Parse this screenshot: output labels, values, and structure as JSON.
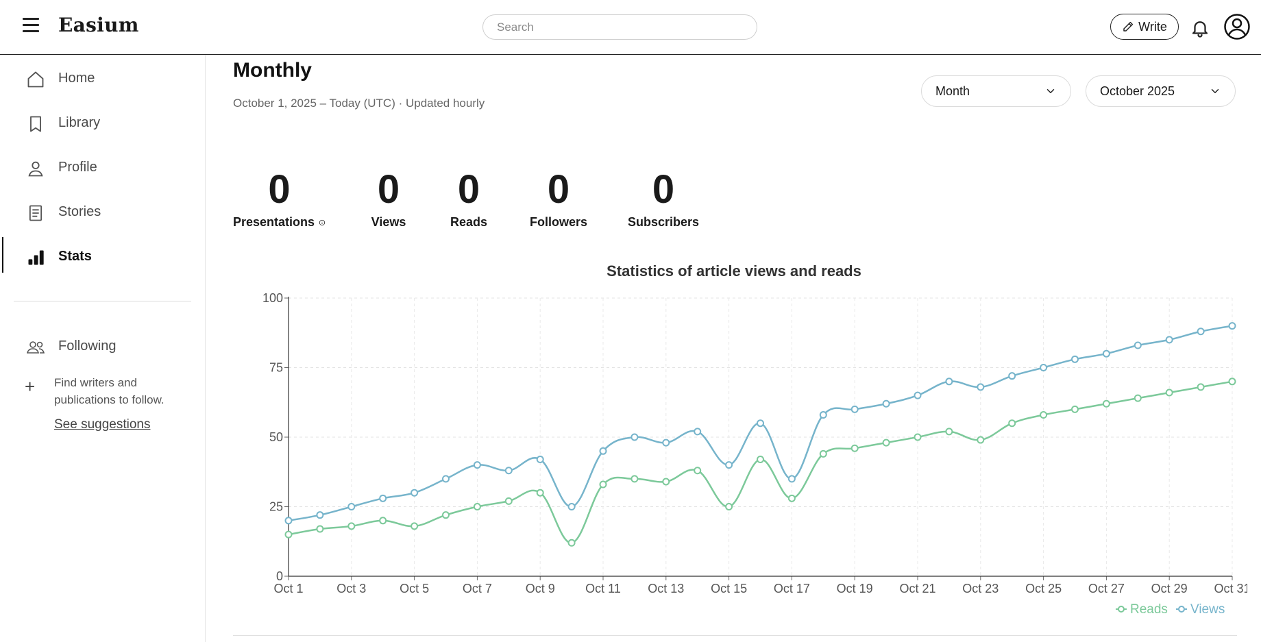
{
  "header": {
    "brand": "Easium",
    "search_placeholder": "Search",
    "write_label": "Write",
    "icons": {
      "menu": "hamburger-icon",
      "write": "pencil-icon",
      "bell": "bell-icon",
      "avatar": "user-circle-icon"
    }
  },
  "sidebar": {
    "items": [
      {
        "label": "Home",
        "icon": "home-icon",
        "active": false
      },
      {
        "label": "Library",
        "icon": "bookmark-icon",
        "active": false
      },
      {
        "label": "Profile",
        "icon": "user-icon",
        "active": false
      },
      {
        "label": "Stories",
        "icon": "document-icon",
        "active": false
      },
      {
        "label": "Stats",
        "icon": "bar-chart-icon",
        "active": true
      }
    ],
    "following_label": "Following",
    "follow_hint": "Find writers and publications to follow.",
    "see_suggestions": "See suggestions"
  },
  "main": {
    "title": "Monthly",
    "subtitle": "October 1, 2025 – Today (UTC) · Updated hourly",
    "period_select": "Month",
    "month_select": "October 2025",
    "stats": [
      {
        "value": "0",
        "label": "Presentations"
      },
      {
        "value": "0",
        "label": "Views"
      },
      {
        "value": "0",
        "label": "Reads"
      },
      {
        "value": "0",
        "label": "Followers"
      },
      {
        "value": "0",
        "label": "Subscribers"
      }
    ],
    "chart_title": "Statistics of article views and reads"
  },
  "chart_data": {
    "type": "line",
    "title": "Statistics of article views and reads",
    "xlabel": "",
    "ylabel": "",
    "ylim": [
      0,
      100
    ],
    "yticks": [
      0,
      25,
      50,
      75,
      100
    ],
    "grid": true,
    "legend": "bottom-right",
    "categories": [
      "Oct 1",
      "Oct 2",
      "Oct 3",
      "Oct 4",
      "Oct 5",
      "Oct 6",
      "Oct 7",
      "Oct 8",
      "Oct 9",
      "Oct 10",
      "Oct 11",
      "Oct 12",
      "Oct 13",
      "Oct 14",
      "Oct 15",
      "Oct 16",
      "Oct 17",
      "Oct 18",
      "Oct 19",
      "Oct 20",
      "Oct 21",
      "Oct 22",
      "Oct 23",
      "Oct 24",
      "Oct 25",
      "Oct 26",
      "Oct 27",
      "Oct 28",
      "Oct 29",
      "Oct 30",
      "Oct 31"
    ],
    "tick_labels": [
      "Oct 1",
      "Oct 3",
      "Oct 5",
      "Oct 7",
      "Oct 9",
      "Oct 11",
      "Oct 13",
      "Oct 15",
      "Oct 17",
      "Oct 19",
      "Oct 21",
      "Oct 23",
      "Oct 25",
      "Oct 27",
      "Oct 29",
      "Oct 31"
    ],
    "series": [
      {
        "name": "Reads",
        "color": "#7cc99a",
        "values": [
          15,
          17,
          18,
          20,
          18,
          22,
          25,
          27,
          30,
          12,
          33,
          35,
          34,
          38,
          25,
          42,
          28,
          44,
          46,
          48,
          50,
          52,
          49,
          55,
          58,
          60,
          62,
          64,
          66,
          68,
          70
        ]
      },
      {
        "name": "Views",
        "color": "#76b4cb",
        "values": [
          20,
          22,
          25,
          28,
          30,
          35,
          40,
          38,
          42,
          25,
          45,
          50,
          48,
          52,
          40,
          55,
          35,
          58,
          60,
          62,
          65,
          70,
          68,
          72,
          75,
          78,
          80,
          83,
          85,
          88,
          90
        ]
      }
    ]
  }
}
